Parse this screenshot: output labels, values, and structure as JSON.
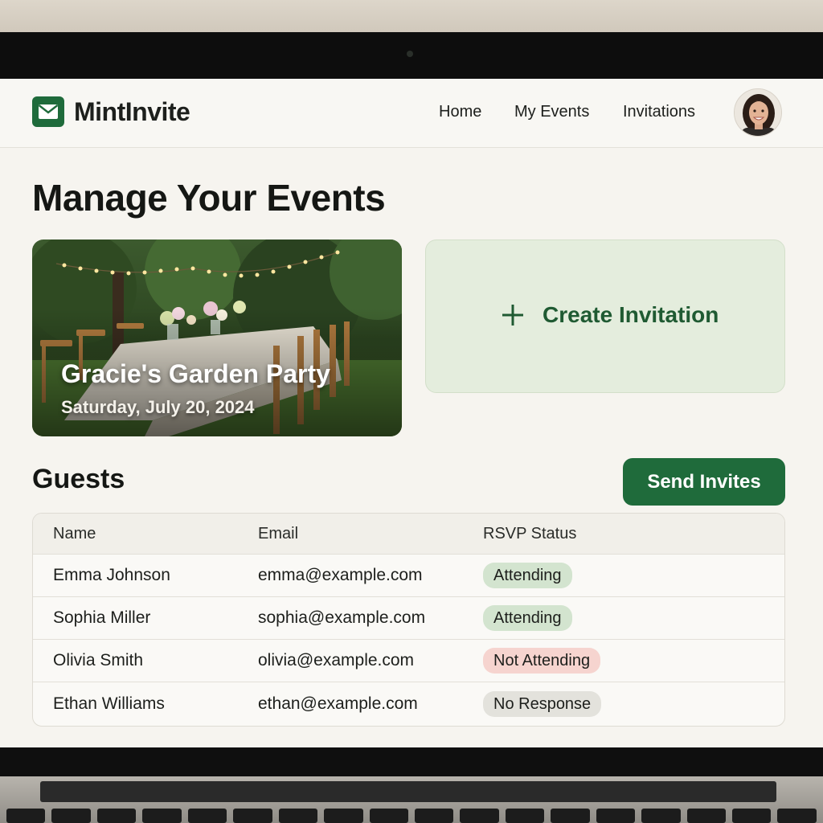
{
  "app": {
    "brand": "MintInvite",
    "nav": [
      "Home",
      "My Events",
      "Invitations"
    ]
  },
  "page": {
    "title": "Manage Your Events"
  },
  "event": {
    "title": "Gracie's Garden Party",
    "date": "Saturday, July 20, 2024"
  },
  "create": {
    "label": "Create Invitation"
  },
  "guests": {
    "title": "Guests",
    "send_label": "Send Invites",
    "columns": [
      "Name",
      "Email",
      "RSVP Status"
    ],
    "rows": [
      {
        "name": "Emma Johnson",
        "email": "emma@example.com",
        "status": "Attending",
        "status_color": "#d3e4cf"
      },
      {
        "name": "Sophia Miller",
        "email": "sophia@example.com",
        "status": "Attending",
        "status_color": "#d3e4cf"
      },
      {
        "name": "Olivia Smith",
        "email": "olivia@example.com",
        "status": "Not Attending",
        "status_color": "#f6d4cf"
      },
      {
        "name": "Ethan Williams",
        "email": "ethan@example.com",
        "status": "No Response",
        "status_color": "#e3e2dc"
      }
    ]
  },
  "colors": {
    "brand": "#1f6b3b",
    "create_card_bg": "#e4eddd",
    "create_text": "#1f5a32"
  },
  "icons": {
    "logo": "envelope-icon",
    "create": "plus-icon"
  }
}
